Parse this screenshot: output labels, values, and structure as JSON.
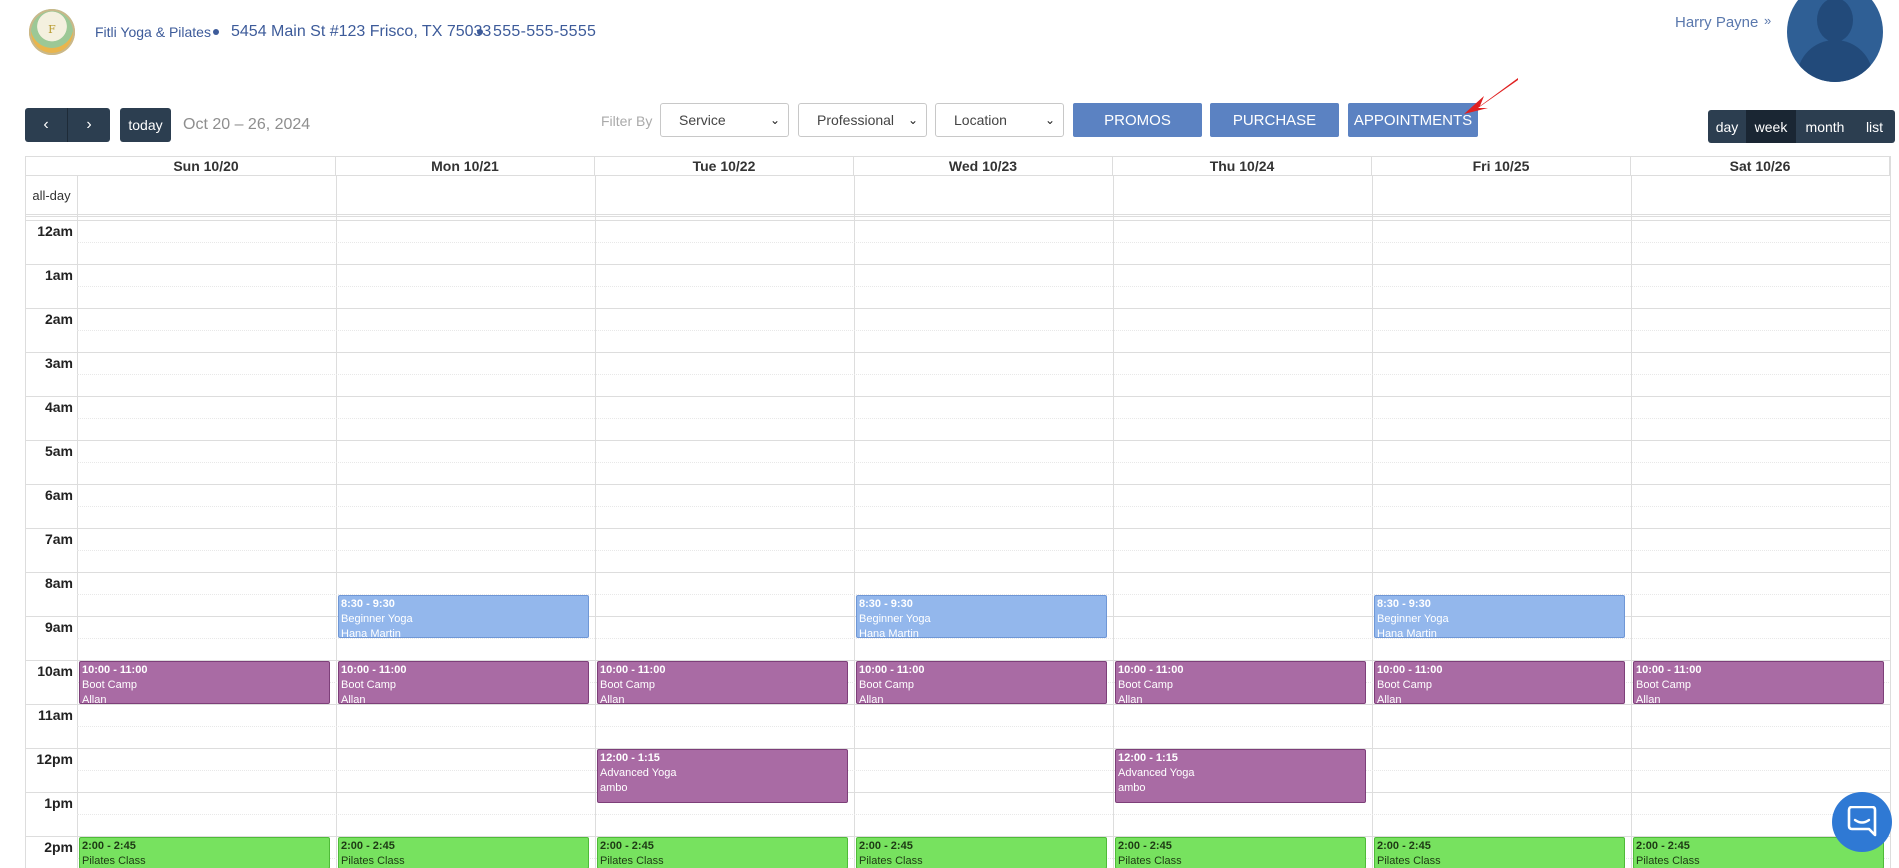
{
  "header": {
    "logo_text": "F",
    "studio_name": "Fitli Yoga & Pilates",
    "address": "5454 Main St #123 Frisco, TX 75033",
    "phone": "555-555-5555",
    "user_name": "Harry Payne"
  },
  "toolbar": {
    "prev_icon": "‹",
    "next_icon": "›",
    "today_label": "today",
    "date_range": "Oct 20 – 26, 2024",
    "filter_by_label": "Filter By",
    "service_select": "Service",
    "professional_select": "Professional",
    "location_select": "Location",
    "promos_label": "PROMOS",
    "purchase_label": "PURCHASE",
    "appointments_label": "APPOINTMENTS",
    "views": {
      "day": "day",
      "week": "week",
      "month": "month",
      "list": "list"
    },
    "active_view": "week"
  },
  "calendar": {
    "all_day_label": "all-day",
    "days": [
      "Sun 10/20",
      "Mon 10/21",
      "Tue 10/22",
      "Wed 10/23",
      "Thu 10/24",
      "Fri 10/25",
      "Sat 10/26"
    ],
    "hours": [
      "12am",
      "1am",
      "2am",
      "3am",
      "4am",
      "5am",
      "6am",
      "7am",
      "8am",
      "9am",
      "10am",
      "11am",
      "12pm",
      "1pm",
      "2pm"
    ],
    "events": [
      {
        "day": 1,
        "start": 8.5,
        "end": 9.5,
        "time": "8:30 - 9:30",
        "name": "Beginner Yoga",
        "professional": "Hana Martin",
        "color": "blue"
      },
      {
        "day": 3,
        "start": 8.5,
        "end": 9.5,
        "time": "8:30 - 9:30",
        "name": "Beginner Yoga",
        "professional": "Hana Martin",
        "color": "blue"
      },
      {
        "day": 5,
        "start": 8.5,
        "end": 9.5,
        "time": "8:30 - 9:30",
        "name": "Beginner Yoga",
        "professional": "Hana Martin",
        "color": "blue"
      },
      {
        "day": 0,
        "start": 10,
        "end": 11,
        "time": "10:00 - 11:00",
        "name": "Boot Camp",
        "professional": "Allan",
        "color": "purple"
      },
      {
        "day": 1,
        "start": 10,
        "end": 11,
        "time": "10:00 - 11:00",
        "name": "Boot Camp",
        "professional": "Allan",
        "color": "purple"
      },
      {
        "day": 2,
        "start": 10,
        "end": 11,
        "time": "10:00 - 11:00",
        "name": "Boot Camp",
        "professional": "Allan",
        "color": "purple"
      },
      {
        "day": 3,
        "start": 10,
        "end": 11,
        "time": "10:00 - 11:00",
        "name": "Boot Camp",
        "professional": "Allan",
        "color": "purple"
      },
      {
        "day": 4,
        "start": 10,
        "end": 11,
        "time": "10:00 - 11:00",
        "name": "Boot Camp",
        "professional": "Allan",
        "color": "purple"
      },
      {
        "day": 5,
        "start": 10,
        "end": 11,
        "time": "10:00 - 11:00",
        "name": "Boot Camp",
        "professional": "Allan",
        "color": "purple"
      },
      {
        "day": 6,
        "start": 10,
        "end": 11,
        "time": "10:00 - 11:00",
        "name": "Boot Camp",
        "professional": "Allan",
        "color": "purple"
      },
      {
        "day": 2,
        "start": 12,
        "end": 13.25,
        "time": "12:00 - 1:15",
        "name": "Advanced Yoga",
        "professional": "ambo",
        "color": "purple"
      },
      {
        "day": 4,
        "start": 12,
        "end": 13.25,
        "time": "12:00 - 1:15",
        "name": "Advanced Yoga",
        "professional": "ambo",
        "color": "purple"
      },
      {
        "day": 0,
        "start": 14,
        "end": 14.75,
        "time": "2:00 - 2:45",
        "name": "Pilates Class",
        "professional": "",
        "color": "green"
      },
      {
        "day": 1,
        "start": 14,
        "end": 14.75,
        "time": "2:00 - 2:45",
        "name": "Pilates Class",
        "professional": "",
        "color": "green"
      },
      {
        "day": 2,
        "start": 14,
        "end": 14.75,
        "time": "2:00 - 2:45",
        "name": "Pilates Class",
        "professional": "",
        "color": "green"
      },
      {
        "day": 3,
        "start": 14,
        "end": 14.75,
        "time": "2:00 - 2:45",
        "name": "Pilates Class",
        "professional": "",
        "color": "green"
      },
      {
        "day": 4,
        "start": 14,
        "end": 14.75,
        "time": "2:00 - 2:45",
        "name": "Pilates Class",
        "professional": "",
        "color": "green"
      },
      {
        "day": 5,
        "start": 14,
        "end": 14.75,
        "time": "2:00 - 2:45",
        "name": "Pilates Class",
        "professional": "",
        "color": "green"
      },
      {
        "day": 6,
        "start": 14,
        "end": 14.75,
        "time": "2:00 - 2:45",
        "name": "Pilates Class",
        "professional": "",
        "color": "green"
      }
    ]
  },
  "colors": {
    "accent": "#5b82c2",
    "nav_dark": "#2c3e50",
    "event_blue": "#93b7ec",
    "event_purple": "#a96ba4",
    "event_green": "#77e25f",
    "chat": "#2f79d4"
  },
  "icons": {
    "chat": "chat-bubble-icon",
    "user_chevron": "double-chevron-down-icon",
    "pointer": "red-arrow-icon"
  }
}
